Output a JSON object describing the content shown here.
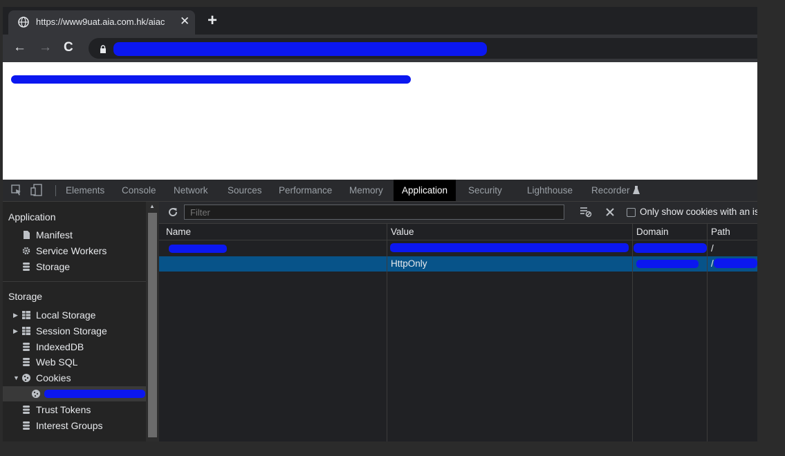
{
  "browser": {
    "tab_title": "https://www9uat.aia.com.hk/aiac",
    "close_glyph": "✕",
    "new_tab_glyph": "+",
    "back_glyph": "←",
    "forward_glyph": "→",
    "reload_glyph": "C"
  },
  "devtools": {
    "tabs": [
      "Elements",
      "Console",
      "Network",
      "Sources",
      "Performance",
      "Memory",
      "Application",
      "Security",
      "Lighthouse",
      "Recorder"
    ],
    "active_tab": "Application"
  },
  "sidebar": {
    "application_header": "Application",
    "application_items": [
      "Manifest",
      "Service Workers",
      "Storage"
    ],
    "storage_header": "Storage",
    "storage_items": [
      "Local Storage",
      "Session Storage",
      "IndexedDB",
      "Web SQL",
      "Cookies"
    ],
    "other_items": [
      "Trust Tokens",
      "Interest Groups"
    ]
  },
  "filter": {
    "placeholder": "Filter",
    "only_show_label": "Only show cookies with an is"
  },
  "table": {
    "headers": [
      "Name",
      "Value",
      "Domain",
      "Path"
    ],
    "rows": [
      {
        "name": "",
        "value": "",
        "domain": "",
        "path": "/"
      },
      {
        "name": "",
        "value": "HttpOnly",
        "domain": "",
        "path": "/"
      }
    ]
  },
  "colors": {
    "selected_row": "#075389",
    "redaction": "#0b17f0"
  }
}
